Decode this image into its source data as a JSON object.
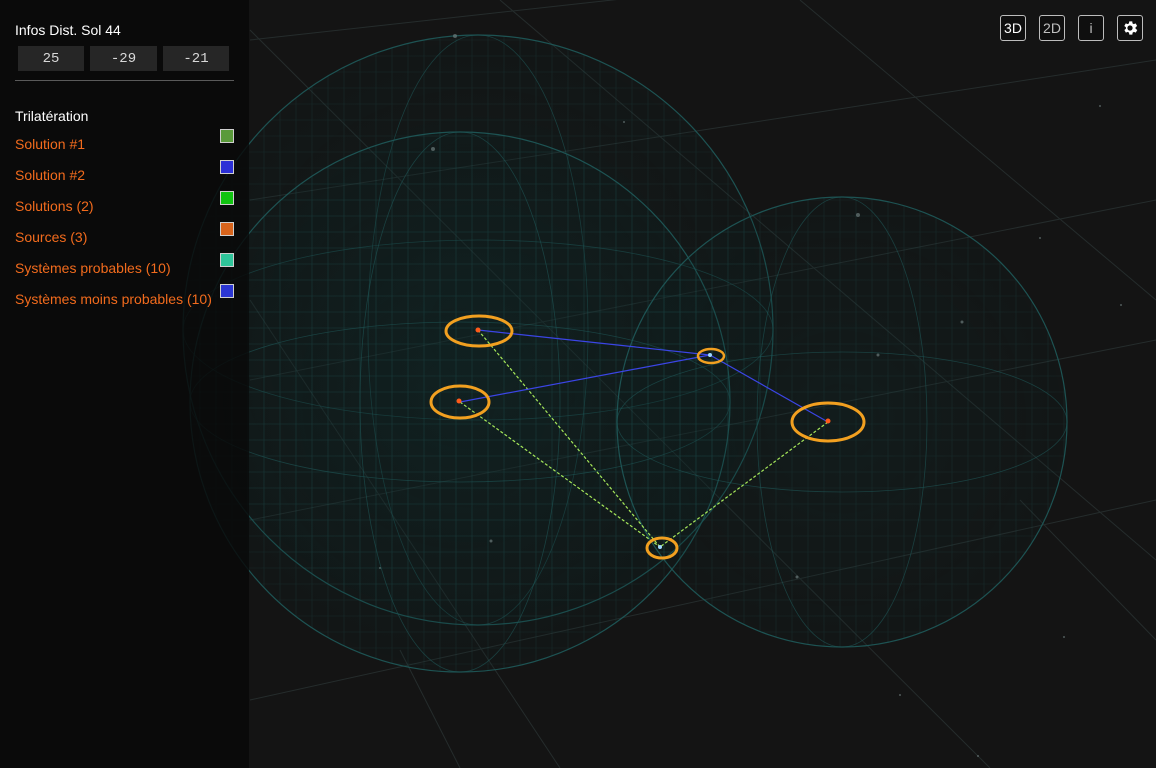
{
  "info": {
    "title": "Infos Dist. Sol 44",
    "coords": [
      "25",
      "-29",
      "-21"
    ]
  },
  "trilateration": {
    "title": "Trilatération",
    "items": [
      {
        "label": "Solution #1",
        "color": "#5a9a3a"
      },
      {
        "label": "Solution #2",
        "color": "#2b2fd6"
      },
      {
        "label": "Solutions (2)",
        "color": "#11c411"
      },
      {
        "label": "Sources (3)",
        "color": "#d8641c"
      },
      {
        "label": "Systèmes probables (10)",
        "color": "#2fc59a"
      },
      {
        "label": "Systèmes moins probables (10)",
        "color": "#2b36d3"
      }
    ]
  },
  "toolbar": {
    "view3d": "3D",
    "view2d": "2D",
    "info": "i",
    "settings_icon": "gear-icon"
  },
  "colors": {
    "accent": "#f26b1d",
    "sphere_wire": "#1f5a5a",
    "marker_ring": "#f2a020",
    "link_green": "#a6e85a",
    "link_blue": "#3b45e6"
  }
}
